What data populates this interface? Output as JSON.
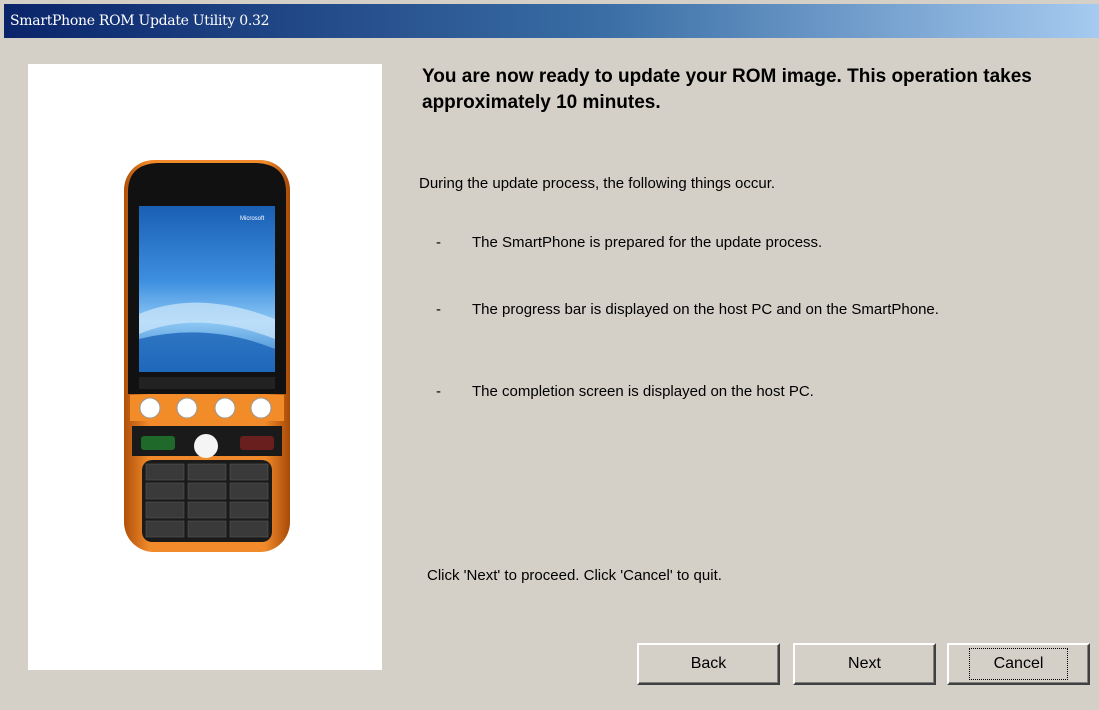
{
  "window": {
    "title": "SmartPhone ROM Update Utility 0.32"
  },
  "main": {
    "heading": "You are now ready to update your ROM image. This operation takes approximately 10 minutes.",
    "intro": "During the update process, the following things occur.",
    "items": [
      {
        "dash": "-",
        "text": "The SmartPhone is prepared for the update process."
      },
      {
        "dash": "-",
        "text": "The progress bar is displayed on the host PC and on the SmartPhone."
      },
      {
        "dash": "-",
        "text": "The completion screen is displayed on the host PC."
      }
    ],
    "instruction": "Click 'Next' to proceed. Click 'Cancel' to quit."
  },
  "buttons": {
    "back": "Back",
    "next": "Next",
    "cancel": "Cancel"
  },
  "phone": {
    "brand": "Microsoft"
  },
  "colors": {
    "title_bar_start": "#0a246a",
    "title_bar_end": "#a6caf0",
    "phone_body": "#e8741a",
    "dialog_bg": "#d4d0c8"
  }
}
